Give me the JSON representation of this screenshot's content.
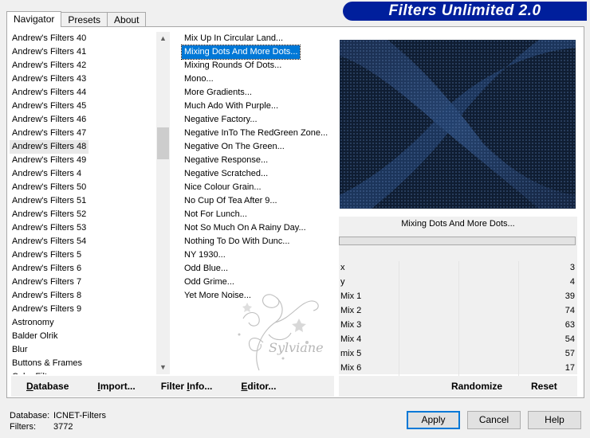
{
  "tabs": [
    "Navigator",
    "Presets",
    "About"
  ],
  "banner_title": "Filters Unlimited 2.0",
  "categories": [
    "Andrew's Filters 40",
    "Andrew's Filters 41",
    "Andrew's Filters 42",
    "Andrew's Filters 43",
    "Andrew's Filters 44",
    "Andrew's Filters 45",
    "Andrew's Filters 46",
    "Andrew's Filters 47",
    "Andrew's Filters 48",
    "Andrew's Filters 49",
    "Andrew's Filters 4",
    "Andrew's Filters 50",
    "Andrew's Filters 51",
    "Andrew's Filters 52",
    "Andrew's Filters 53",
    "Andrew's Filters 54",
    "Andrew's Filters 5",
    "Andrew's Filters 6",
    "Andrew's Filters 7",
    "Andrew's Filters 8",
    "Andrew's Filters 9",
    "Astronomy",
    "Balder Olrik",
    "Blur",
    "Buttons & Frames",
    "Color Filters"
  ],
  "selected_category": "Andrew's Filters 48",
  "filters": [
    "Mix Up In Circular Land...",
    "Mixing Dots And More Dots...",
    "Mixing Rounds Of Dots...",
    "Mono...",
    "More Gradients...",
    "Much Ado With Purple...",
    "Negative Factory...",
    "Negative InTo The RedGreen Zone...",
    "Negative On The Green...",
    "Negative Response...",
    "Negative Scratched...",
    "Nice Colour Grain...",
    "No Cup Of Tea After 9...",
    "Not For Lunch...",
    "Not So Much On A Rainy Day...",
    "Nothing To Do With Dunc...",
    "NY 1930...",
    "Odd Blue...",
    "Odd Grime...",
    "Yet More Noise..."
  ],
  "selected_filter": "Mixing Dots And More Dots...",
  "current_filter_title": "Mixing Dots And More Dots...",
  "params": [
    {
      "name": "x",
      "value": "3"
    },
    {
      "name": "y",
      "value": "4"
    },
    {
      "name": "Mix 1",
      "value": "39"
    },
    {
      "name": "Mix 2",
      "value": "74"
    },
    {
      "name": "Mix 3",
      "value": "63"
    },
    {
      "name": "Mix 4",
      "value": "54"
    },
    {
      "name": "mix 5",
      "value": "57"
    },
    {
      "name": "Mix 6",
      "value": "17"
    }
  ],
  "left_buttons": {
    "database": {
      "u": "D",
      "rest": "atabase"
    },
    "import": {
      "u": "I",
      "rest": "mport..."
    },
    "filter_info": {
      "pre": "Filter ",
      "u": "I",
      "rest": "nfo..."
    },
    "editor": {
      "u": "E",
      "rest": "ditor..."
    }
  },
  "randomize_label": "Randomize",
  "reset_label": "Reset",
  "status": {
    "database_label": "Database:",
    "database_value": "ICNET-Filters",
    "filters_label": "Filters:",
    "filters_value": "3772"
  },
  "apply_label": "Apply",
  "cancel_label": "Cancel",
  "help_label": "Help",
  "watermark_text": "Sylviane",
  "colors": {
    "banner": "#001f9c",
    "selection": "#0078d7",
    "preview_bg": "#0f1d32"
  }
}
